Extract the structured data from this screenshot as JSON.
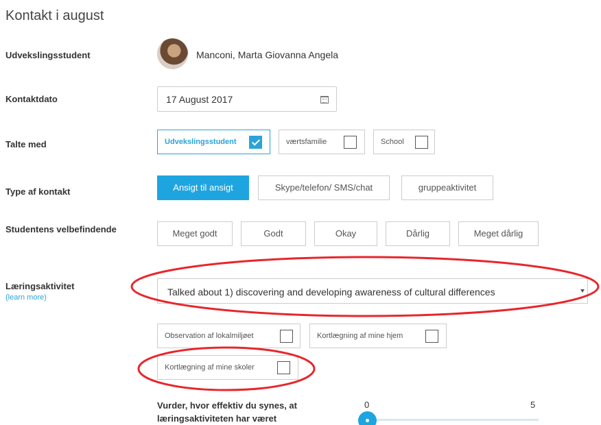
{
  "page": {
    "title": "Kontakt i august"
  },
  "labels": {
    "student": "Udvekslingsstudent",
    "contact_date": "Kontaktdato",
    "talked_with": "Talte med",
    "contact_type": "Type af kontakt",
    "wellbeing": "Studentens velbefindende",
    "learning_activity": "Læringsaktivitet",
    "learn_more": "(learn more)"
  },
  "student": {
    "name": "Manconi, Marta Giovanna Angela"
  },
  "contact_date": {
    "value": "17 August 2017"
  },
  "talked_with": [
    {
      "label": "Udvekslingsstudent",
      "checked": true
    },
    {
      "label": "værtsfamilie",
      "checked": false
    },
    {
      "label": "School",
      "checked": false
    }
  ],
  "contact_type": [
    {
      "label": "Ansigt til ansigt",
      "selected": true
    },
    {
      "label": "Skype/telefon/ SMS/chat",
      "selected": false
    },
    {
      "label": "gruppeaktivitet",
      "selected": false
    }
  ],
  "wellbeing": [
    {
      "label": "Meget godt"
    },
    {
      "label": "Godt"
    },
    {
      "label": "Okay"
    },
    {
      "label": "Dårlig"
    },
    {
      "label": "Meget dårlig"
    }
  ],
  "learning_activity": {
    "selected": "Talked about 1) discovering and developing awareness of cultural differences",
    "options": [
      {
        "label": "Observation af lokalmiljøet",
        "checked": false
      },
      {
        "label": "Kortlægning af mine hjem",
        "checked": false
      },
      {
        "label": "Kortlægning af mine skoler",
        "checked": false
      }
    ]
  },
  "rating": {
    "question": "Vurder, hvor effektiv du synes, at læringsaktiviteten har været",
    "min_label": "0",
    "max_label": "5",
    "value": 0
  },
  "colors": {
    "accent": "#1ea5e0",
    "annotation": "#e8262c"
  }
}
